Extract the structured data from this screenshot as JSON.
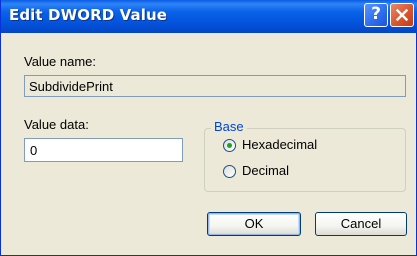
{
  "window": {
    "title": "Edit DWORD Value"
  },
  "title_buttons": {
    "help_glyph": "?"
  },
  "value_name": {
    "label": "Value name:",
    "value": "SubdividePrint"
  },
  "value_data": {
    "label": "Value data:",
    "value": "0"
  },
  "base": {
    "legend": "Base",
    "options": [
      {
        "label": "Hexadecimal",
        "selected": true
      },
      {
        "label": "Decimal",
        "selected": false
      }
    ]
  },
  "buttons": {
    "ok_label": "OK",
    "cancel_label": "Cancel"
  },
  "colors": {
    "title_bar": "#0453dc",
    "dialog_face": "#ece9d8",
    "group_legend": "#0046d5",
    "radio_dot": "#21a121",
    "close_button": "#d9552c"
  },
  "icons": {
    "help": "help-icon",
    "close": "close-icon"
  }
}
